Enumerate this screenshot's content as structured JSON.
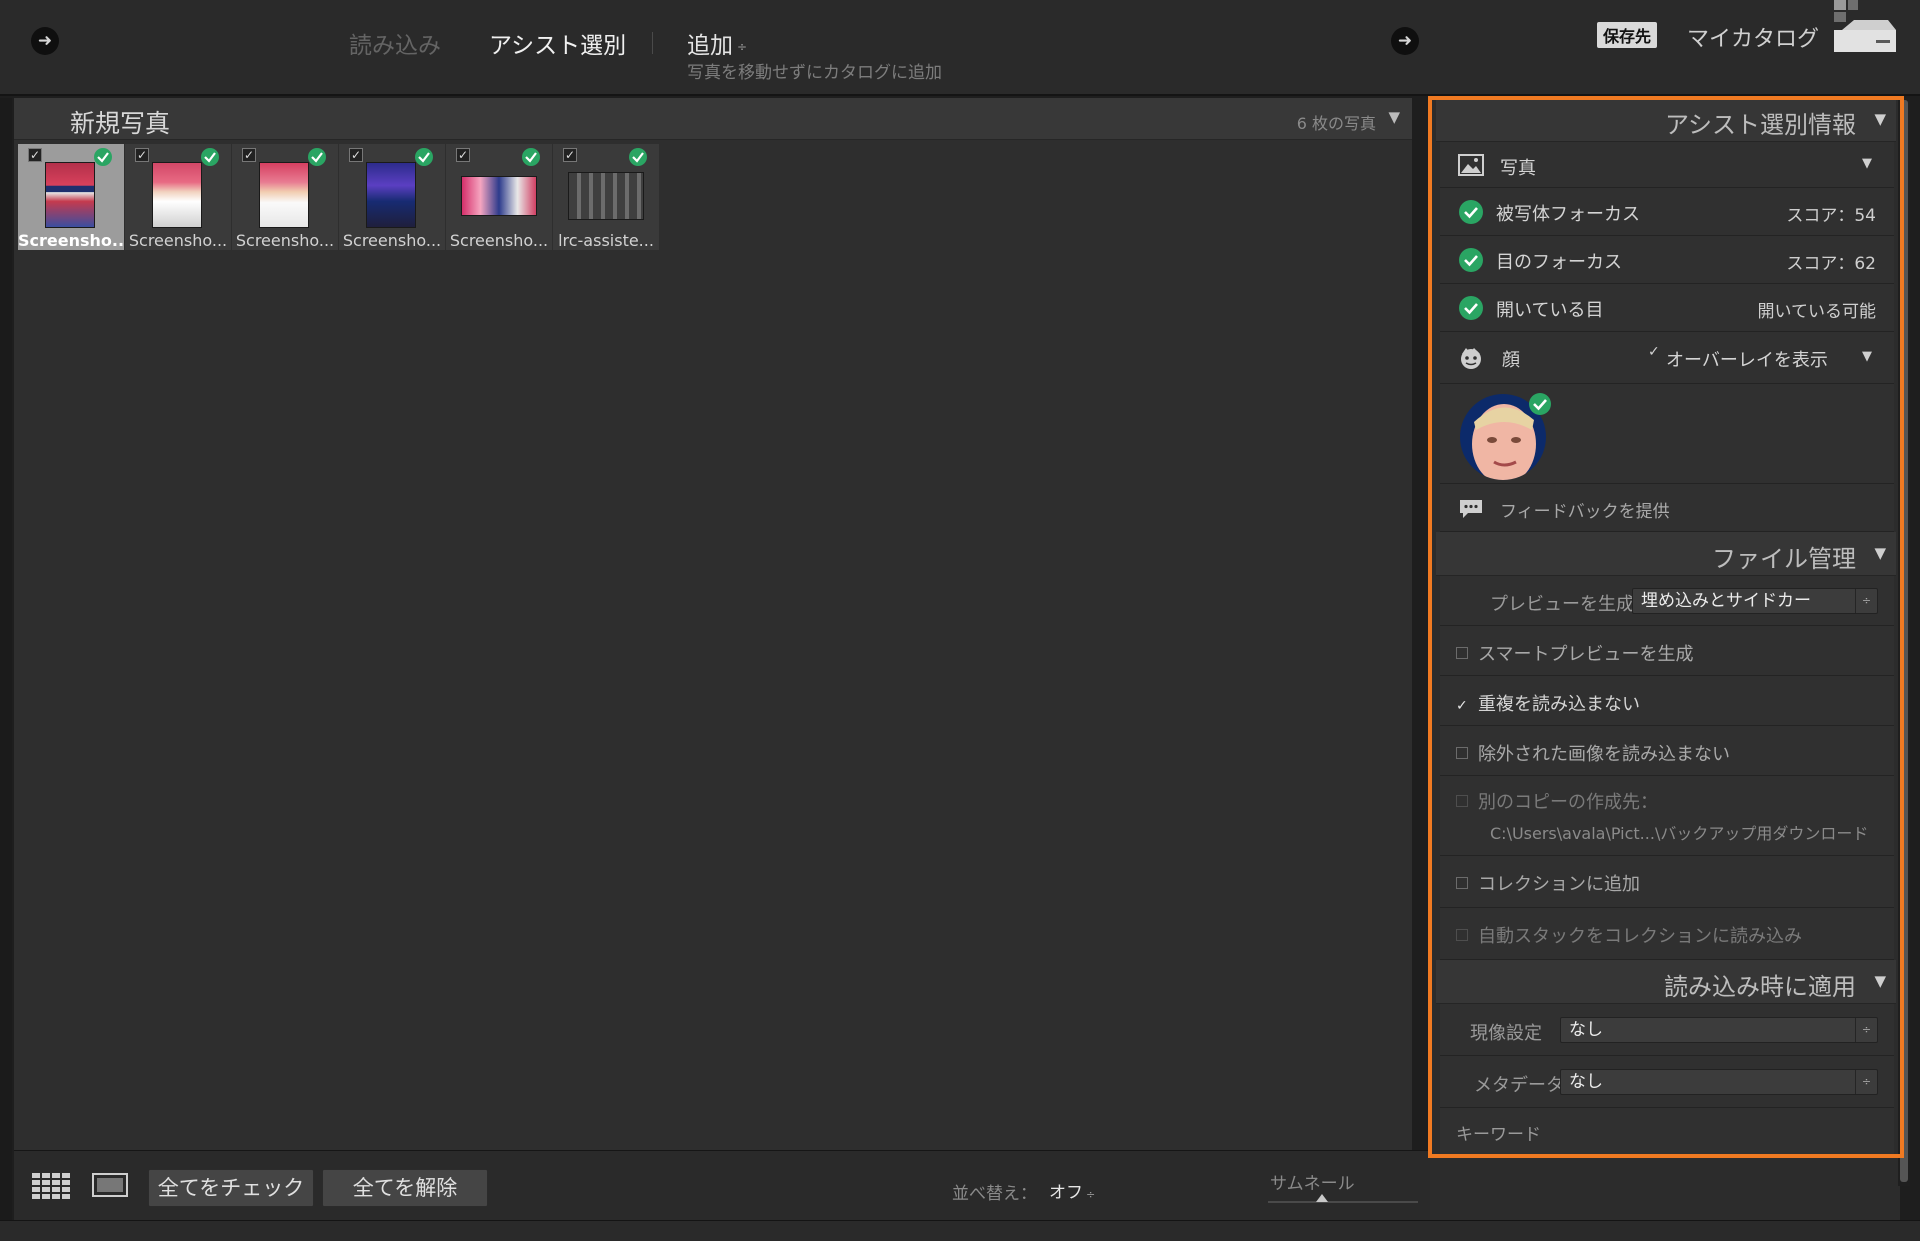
{
  "topbar": {
    "import_label": "読み込み",
    "assist_label": "アシスト選別",
    "add_label": "追加",
    "add_caret": "÷",
    "add_subtitle": "写真を移動せずにカタログに追加",
    "dest_badge": "保存先",
    "catalog_name": "マイカタログ",
    "arrow_glyph": "➜"
  },
  "grid": {
    "title": "新規写真",
    "photo_count": "6 枚の写真",
    "caret": "▼",
    "thumbnails": [
      {
        "name": "Screensho...",
        "checked": "✓"
      },
      {
        "name": "Screensho...",
        "checked": "✓"
      },
      {
        "name": "Screensho...",
        "checked": "✓"
      },
      {
        "name": "Screensho...",
        "checked": "✓"
      },
      {
        "name": "Screensho...",
        "checked": "✓"
      },
      {
        "name": "lrc-assiste...",
        "checked": "✓"
      }
    ]
  },
  "toolbar": {
    "check_all": "全てをチェック",
    "uncheck_all": "全てを解除",
    "sort_label": "並べ替え：",
    "sort_value": "オフ",
    "sort_caret": "÷",
    "thumb_label": "サムネール"
  },
  "assist_info": {
    "title": "アシスト選別情報",
    "caret": "▼",
    "photo_label": "写真",
    "subject_focus": "被写体フォーカス",
    "subject_score": "スコア：54",
    "eye_focus": "目のフォーカス",
    "eye_score": "スコア：62",
    "open_eyes": "開いている目",
    "open_eyes_value": "開いている可能",
    "face_label": "顔",
    "overlay_check": "✓",
    "overlay_label": "オーバーレイを表示",
    "feedback": "フィードバックを提供"
  },
  "file_handling": {
    "title": "ファイル管理",
    "caret": "▼",
    "preview_label": "プレビューを生成",
    "preview_value": "埋め込みとサイドカー",
    "select_arrows": "÷",
    "smart_preview": "スマートプレビューを生成",
    "no_duplicates_check": "✓",
    "no_duplicates": "重複を読み込まない",
    "no_rejected": "除外された画像を読み込まない",
    "second_copy": "別のコピーの作成先：",
    "second_copy_path": "C:\\Users\\avala\\Pict...\\バックアップ用ダウンロード",
    "add_collection": "コレクションに追加",
    "auto_stack": "自動スタックをコレクションに読み込み"
  },
  "apply_on_import": {
    "title": "読み込み時に適用",
    "caret": "▼",
    "develop_label": "現像設定",
    "develop_value": "なし",
    "metadata_label": "メタデータ",
    "metadata_value": "なし",
    "keywords_label": "キーワード"
  },
  "colors": {
    "accent_outline": "#f07a22",
    "check_green": "#2aa563",
    "panel_bg": "#2c2c2c"
  }
}
